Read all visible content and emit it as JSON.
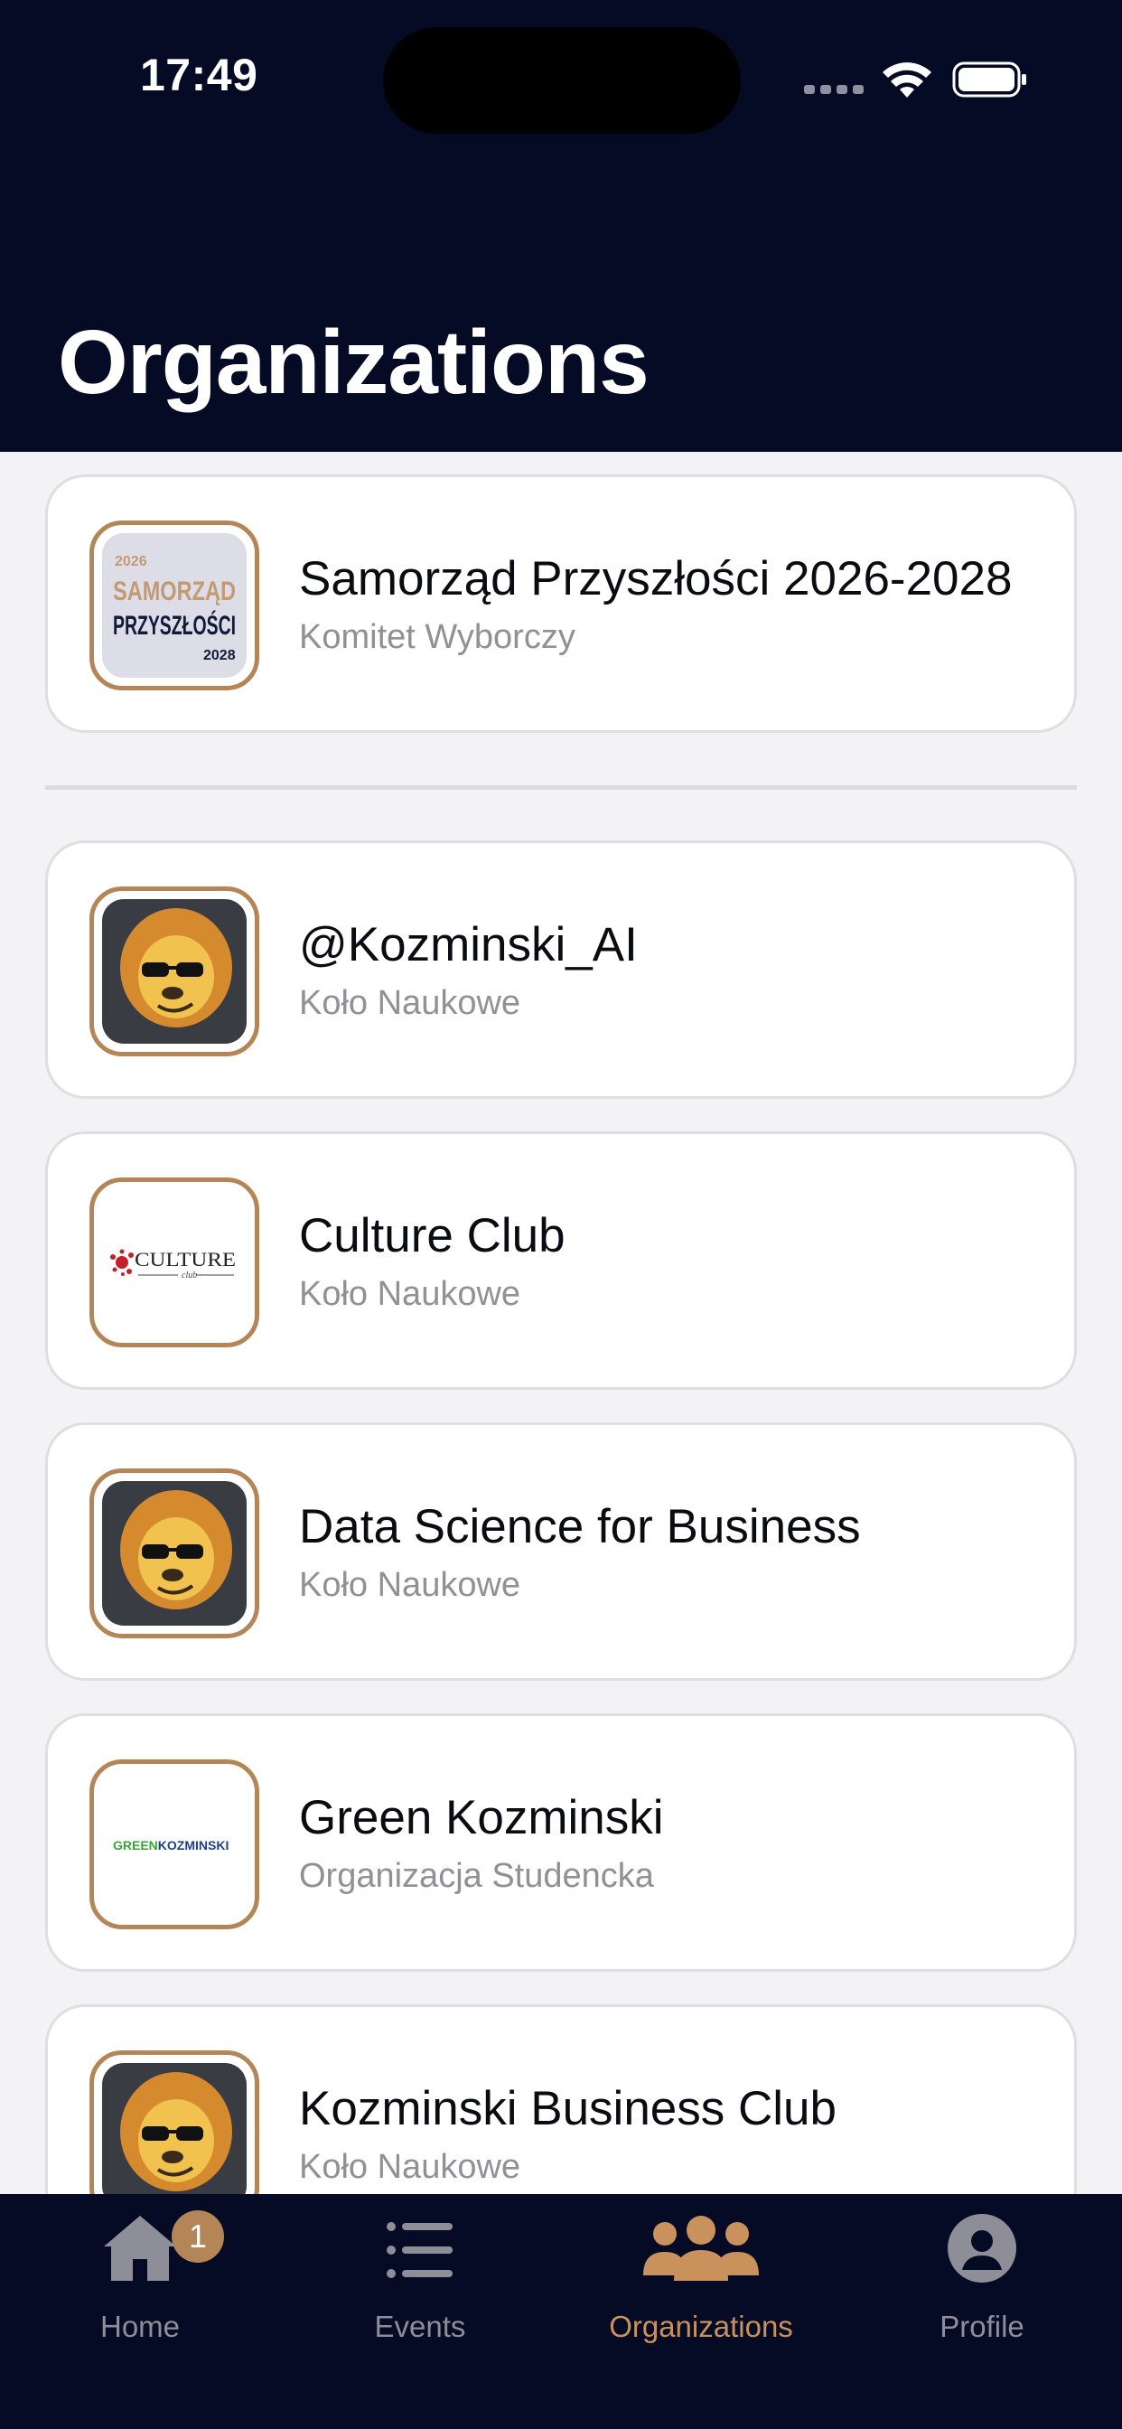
{
  "status_bar": {
    "time": "17:49"
  },
  "header": {
    "title": "Organizations"
  },
  "featured": {
    "name": "Samorząd Przyszłości 2026-2028",
    "type": "Komitet Wyborczy",
    "logo_icon": "samorzad-przyszlosci-logo",
    "logo_text": [
      "2026",
      "SAMORZĄD",
      "PRZYSZŁOŚCI",
      "2028"
    ]
  },
  "organizations": [
    {
      "name": "@Kozminski_AI",
      "type": "Koło Naukowe",
      "logo_icon": "lion-mascot-logo"
    },
    {
      "name": "Culture Club",
      "type": "Koło Naukowe",
      "logo_icon": "culture-club-logo",
      "logo_text": [
        "CULTURE",
        "club"
      ]
    },
    {
      "name": "Data Science for Business",
      "type": "Koło Naukowe",
      "logo_icon": "lion-mascot-logo"
    },
    {
      "name": "Green Kozminski",
      "type": "Organizacja Studencka",
      "logo_icon": "green-kozminski-logo",
      "logo_text": [
        "GREEN",
        "KOZMINSKI"
      ]
    },
    {
      "name": "Kozminski Business Club",
      "type": "Koło Naukowe",
      "logo_icon": "lion-mascot-logo"
    }
  ],
  "tab_bar": {
    "tabs": [
      {
        "label": "Home",
        "icon": "home-icon",
        "badge": "1",
        "active": false
      },
      {
        "label": "Events",
        "icon": "list-icon",
        "active": false
      },
      {
        "label": "Organizations",
        "icon": "people-icon",
        "active": true
      },
      {
        "label": "Profile",
        "icon": "person-icon",
        "active": false
      }
    ]
  },
  "colors": {
    "header_bg": "#050a25",
    "accent": "#c9915c",
    "logo_border": "#b48556",
    "inactive_tab": "#8e8e98"
  }
}
